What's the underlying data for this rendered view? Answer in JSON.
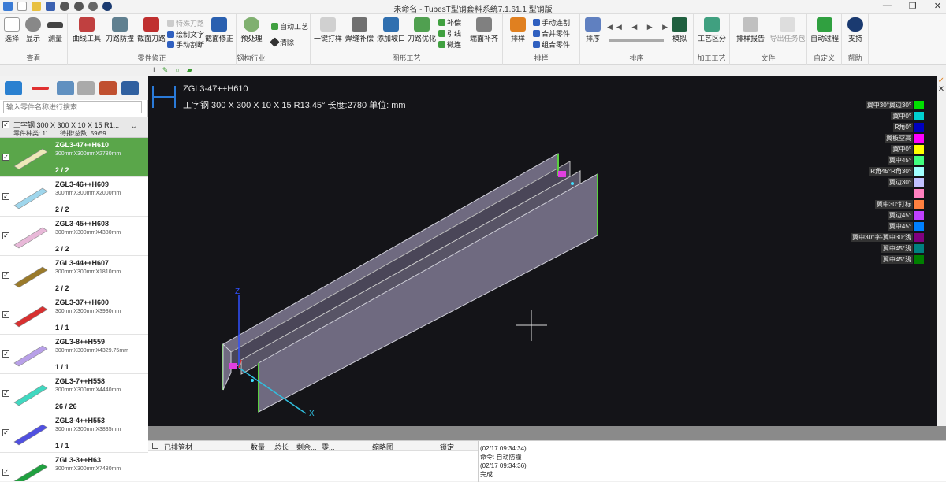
{
  "window": {
    "title": "未命名 - TubesT型钢套料系统7.1.61.1  型钢版"
  },
  "ribbon": {
    "groups": [
      {
        "label": "查看",
        "buttons": [
          "选择",
          "显示",
          "测量"
        ]
      },
      {
        "label": "零件修正",
        "buttons": [
          "曲线工具",
          "刀路防撞",
          "截面刀路",
          "截面修正"
        ],
        "small": [
          "特殊刀路",
          "绘制文字",
          "手动割断"
        ]
      },
      {
        "label": "钢构行业",
        "buttons": [
          "预处理"
        ]
      },
      {
        "label": "",
        "small": [
          "自动工艺",
          "清除"
        ]
      },
      {
        "label": "图形工艺",
        "buttons": [
          "一键打样",
          "焊缝补偿",
          "添加坡口",
          "刀路优化",
          "端面补齐"
        ],
        "small": [
          "补偿",
          "引线",
          "微连"
        ]
      },
      {
        "label": "排样",
        "buttons": [
          "排样"
        ],
        "small": [
          "手动连割",
          "合并零件",
          "组合零件"
        ]
      },
      {
        "label": "排序",
        "buttons": [
          "排序",
          "模拟"
        ]
      },
      {
        "label": "加工工艺",
        "buttons": [
          "工艺区分"
        ]
      },
      {
        "label": "文件",
        "buttons": [
          "排样报告",
          "导出任务包"
        ]
      },
      {
        "label": "自定义",
        "buttons": [
          "自动过程"
        ]
      },
      {
        "label": "帮助",
        "buttons": [
          "支持"
        ]
      }
    ]
  },
  "sidebar": {
    "search_placeholder": "输入零件名称进行搜索",
    "group_title": "工字钢 300 X 300 X 10 X 15  R1...",
    "part_types": "零件种类:  11",
    "pending_total": "待排/总数: 59/59",
    "parts": [
      {
        "name": "ZGL3-47++H610",
        "dim": "300mmX300mmX2780mm",
        "count": "2 / 2",
        "color": "#ede8b8"
      },
      {
        "name": "ZGL3-46++H609",
        "dim": "300mmX300mmX2000mm",
        "count": "2 / 2",
        "color": "#9fd6ec"
      },
      {
        "name": "ZGL3-45++H608",
        "dim": "300mmX300mmX4380mm",
        "count": "2 / 2",
        "color": "#e8b8d8"
      },
      {
        "name": "ZGL3-44++H607",
        "dim": "300mmX300mmX1810mm",
        "count": "2 / 2",
        "color": "#9a7a2a"
      },
      {
        "name": "ZGL3-37++H600",
        "dim": "300mmX300mmX3930mm",
        "count": "1 / 1",
        "color": "#d83030"
      },
      {
        "name": "ZGL3-8++H559",
        "dim": "300mmX300mmX4329.75mm",
        "count": "1 / 1",
        "color": "#b8a0e8"
      },
      {
        "name": "ZGL3-7++H558",
        "dim": "300mmX300mmX4440mm",
        "count": "26 / 26",
        "color": "#40d8c0"
      },
      {
        "name": "ZGL3-4++H553",
        "dim": "300mmX300mmX3835mm",
        "count": "1 / 1",
        "color": "#5050e0"
      },
      {
        "name": "ZGL3-3++H63",
        "dim": "300mmX300mmX7480mm",
        "count": "",
        "color": "#20a040"
      }
    ]
  },
  "viewport": {
    "part_name": "ZGL3-47++H610",
    "part_desc": "工字钢 300 X 300 X 10 X 15  R13,45° 长度:2780 单位: mm",
    "axis_x": "X",
    "axis_z": "Z"
  },
  "legend": [
    {
      "label": "翼中30°翼边30°",
      "color": "#00e000"
    },
    {
      "label": "翼中0°",
      "color": "#00d0d0"
    },
    {
      "label": "R角0°",
      "color": "#0000c0"
    },
    {
      "label": "翼板空高",
      "color": "#ff00ff"
    },
    {
      "label": "翼中0°",
      "color": "#ffff00"
    },
    {
      "label": "翼中45°",
      "color": "#40ff80"
    },
    {
      "label": "R角45°R角30°",
      "color": "#a0ffff"
    },
    {
      "label": "翼边30°",
      "color": "#c0c0ff"
    },
    {
      "label": "",
      "color": "#ff80c0"
    },
    {
      "label": "翼中30°打标",
      "color": "#ff8040"
    },
    {
      "label": "翼边45°",
      "color": "#c040ff"
    },
    {
      "label": "翼中45°",
      "color": "#0080ff"
    },
    {
      "label": "翼中30°字-翼中30°浅",
      "color": "#800080"
    },
    {
      "label": "翼中45°浅",
      "color": "#008080"
    },
    {
      "label": "翼中45°浅",
      "color": "#008000"
    }
  ],
  "bottom_table": {
    "headers": [
      "已排管材",
      "数量",
      "总长",
      "剩余...",
      "零...",
      "缩略图",
      "锁定"
    ]
  },
  "log": [
    "(02/17 09:34:34)",
    "命令: 自动防撞",
    "(02/17 09:34:36)",
    "完成"
  ]
}
